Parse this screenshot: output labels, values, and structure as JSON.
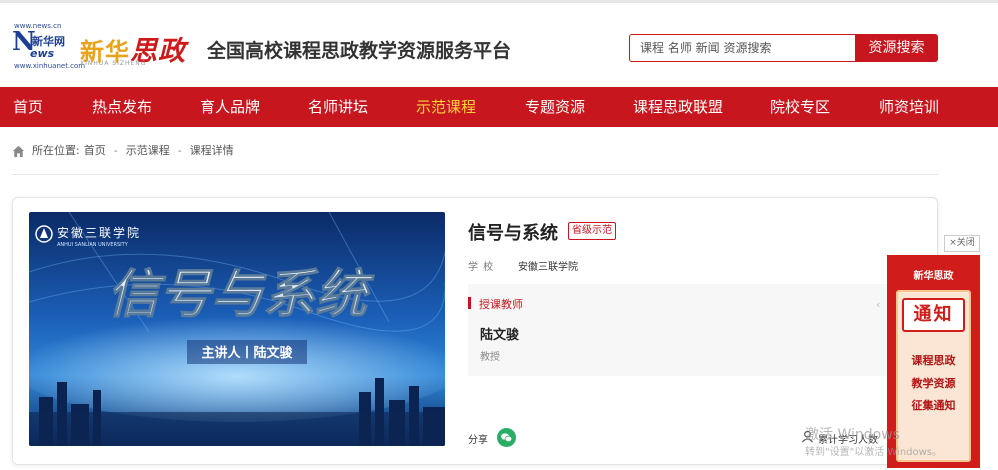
{
  "header": {
    "logo": {
      "url_top": "www.news.cn",
      "letter": "N",
      "cn": "新华网",
      "ews": "ews",
      "url_bottom": "www.xinhuanet.com"
    },
    "brand": {
      "part1": "新华",
      "part2": "思政",
      "sub": "XINHUA SIZHENG"
    },
    "site_title": "全国高校课程思政教学资源服务平台",
    "search": {
      "placeholder": "课程 名师 新闻 资源搜索",
      "button_label": "资源搜索"
    }
  },
  "nav": {
    "items": [
      {
        "label": "首页"
      },
      {
        "label": "热点发布"
      },
      {
        "label": "育人品牌"
      },
      {
        "label": "名师讲坛"
      },
      {
        "label": "示范课程",
        "active": true
      },
      {
        "label": "专题资源"
      },
      {
        "label": "课程思政联盟"
      },
      {
        "label": "院校专区"
      },
      {
        "label": "师资培训"
      }
    ],
    "background": "#c7161e",
    "active_color": "#ffd43b"
  },
  "breadcrumb": {
    "prefix": "所在位置:",
    "items": [
      "首页",
      "示范课程",
      "课程详情"
    ],
    "separator": "-"
  },
  "course": {
    "cover": {
      "school_logo_text": "安徽三联学院",
      "school_logo_en": "ANHUI SANLIAN UNIVERSITY",
      "title_art": "信号与系统",
      "presenter": "主讲人丨陆文骏"
    },
    "title": "信号与系统",
    "level_badge": "省级示范",
    "school_label": "学  校",
    "school_name": "安徽三联学院",
    "teacher_heading": "授课教师",
    "teacher_name": "陆文骏",
    "teacher_role": "教授",
    "share_label": "分享",
    "learners_label": "累计学习人数"
  },
  "ad": {
    "close_label": "×关闭",
    "brand": "新华思政",
    "notice": "通知",
    "lines": [
      "课程思政",
      "教学资源",
      "征集通知"
    ]
  },
  "watermark": {
    "line1": "激活 Windows",
    "line2": "转到\"设置\"以激活 Windows。"
  },
  "colors": {
    "brand_red": "#c7161e",
    "brand_gold": "#e9a319"
  }
}
